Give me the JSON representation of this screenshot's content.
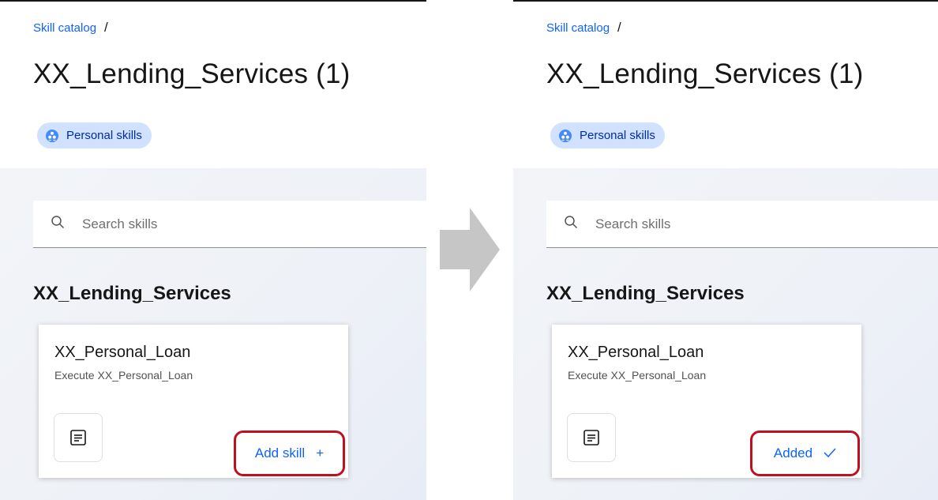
{
  "panels": {
    "left": {
      "breadcrumb": {
        "link": "Skill catalog",
        "separator": "/"
      },
      "title": "XX_Lending_Services (1)",
      "tag": {
        "label": "Personal skills",
        "icon": "person-group-icon"
      },
      "search": {
        "placeholder": "Search skills",
        "icon": "search-icon"
      },
      "section_title": "XX_Lending_Services",
      "card": {
        "title": "XX_Personal_Loan",
        "description": "Execute XX_Personal_Loan",
        "icon": "document-lines-icon",
        "action": {
          "label": "Add skill",
          "symbol": "+",
          "icon": "plus-icon"
        }
      }
    },
    "right": {
      "breadcrumb": {
        "link": "Skill catalog",
        "separator": "/"
      },
      "title": "XX_Lending_Services (1)",
      "tag": {
        "label": "Personal skills",
        "icon": "person-group-icon"
      },
      "search": {
        "placeholder": "Search skills",
        "icon": "search-icon"
      },
      "section_title": "XX_Lending_Services",
      "card": {
        "title": "XX_Personal_Loan",
        "description": "Execute XX_Personal_Loan",
        "icon": "document-lines-icon",
        "action": {
          "label": "Added",
          "icon": "checkmark-icon"
        }
      }
    }
  },
  "transition_arrow": {
    "icon": "right-arrow-icon",
    "color": "#c6c6c6"
  },
  "colors": {
    "link": "#0f62fe",
    "tag_background": "#d0e2ff",
    "tag_text": "#002d9c",
    "highlight_border": "#c0101f",
    "content_background": "#f2f4f8"
  }
}
